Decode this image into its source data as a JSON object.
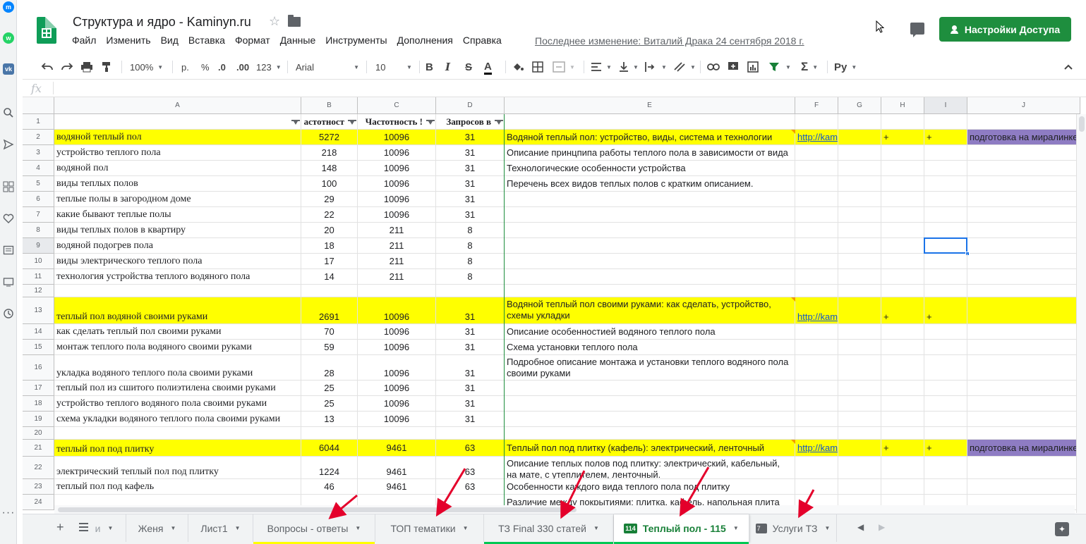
{
  "doc": {
    "title": "Структура и ядро - Kaminyn.ru",
    "menu": [
      "Файл",
      "Изменить",
      "Вид",
      "Вставка",
      "Формат",
      "Данные",
      "Инструменты",
      "Дополнения",
      "Справка"
    ],
    "last_edit": "Последнее изменение: Виталий Драка 24 сентября 2018 г.",
    "share_label": "Настройки Доступа"
  },
  "toolbar": {
    "zoom": "100%",
    "currency": "р.",
    "percent": "%",
    "dec_less": ".0",
    "dec_more": ".00",
    "format_more": "123",
    "font": "Arial",
    "font_size": "10",
    "bold": "B",
    "italic": "I",
    "strike": "S",
    "text_color": "A",
    "sigma": "Σ",
    "input_tools": "Pу"
  },
  "formula": {
    "fx": "fx",
    "value": ""
  },
  "columns": [
    "A",
    "B",
    "C",
    "D",
    "E",
    "F",
    "G",
    "H",
    "I",
    "J"
  ],
  "header_row": {
    "num": "1",
    "B": "астотност",
    "C": "Частотность !",
    "D": "Запросов в"
  },
  "rows": [
    {
      "num": "2",
      "A": "водяной теплый пол",
      "B": "5272",
      "C": "10096",
      "D": "31",
      "E": "Водяной теплый пол: устройство, виды, система и технологии",
      "F": "http://kaminyn.ru/tyo",
      "H": "+",
      "I": "+",
      "J": "подготовка на миралинке",
      "yellow": true
    },
    {
      "num": "3",
      "A": "устройство теплого пола",
      "B": "218",
      "C": "10096",
      "D": "31",
      "E": "Описание принцпипа работы теплого пола в зависимости от вида"
    },
    {
      "num": "4",
      "A": "водяной пол",
      "B": "148",
      "C": "10096",
      "D": "31",
      "E": "Технологические особенности устройства"
    },
    {
      "num": "5",
      "A": "виды теплых полов",
      "B": "100",
      "C": "10096",
      "D": "31",
      "E": "Перечень всех видов теплых полов с кратким описанием."
    },
    {
      "num": "6",
      "A": "теплые полы в загородном доме",
      "B": "29",
      "C": "10096",
      "D": "31"
    },
    {
      "num": "7",
      "A": "какие бывают теплые полы",
      "B": "22",
      "C": "10096",
      "D": "31"
    },
    {
      "num": "8",
      "A": "виды теплых полов в квартиру",
      "B": "20",
      "C": "211",
      "D": "8"
    },
    {
      "num": "9",
      "A": "водяной подогрев пола",
      "B": "18",
      "C": "211",
      "D": "8"
    },
    {
      "num": "10",
      "A": "виды электрического теплого пола",
      "B": "17",
      "C": "211",
      "D": "8"
    },
    {
      "num": "11",
      "A": "технология устройства теплого водяного пола",
      "B": "14",
      "C": "211",
      "D": "8"
    },
    {
      "num": "12"
    },
    {
      "num": "13",
      "A": "теплый пол водяной своими руками",
      "B": "2691",
      "C": "10096",
      "D": "31",
      "E": "Водяной теплый пол своими руками: как сделать, устройство, схемы укладки",
      "F": "http://kaminyn.ru/tyo",
      "H": "+",
      "I": "+",
      "yellow": true
    },
    {
      "num": "14",
      "A": "как сделать теплый пол своими руками",
      "B": "70",
      "C": "10096",
      "D": "31",
      "E": "Описание особенностией водяного теплого пола"
    },
    {
      "num": "15",
      "A": "монтаж теплого пола водяного своими руками",
      "B": "59",
      "C": "10096",
      "D": "31",
      "E": "Схема установки теплого пола"
    },
    {
      "num": "16",
      "A": "укладка водяного теплого пола своими руками",
      "B": "28",
      "C": "10096",
      "D": "31",
      "E": "Подробное описание монтажа и установки теплого водяного пола своими руками"
    },
    {
      "num": "17",
      "A": "теплый пол из сшитого полиэтилена своими руками",
      "B": "25",
      "C": "10096",
      "D": "31"
    },
    {
      "num": "18",
      "A": "устройство теплого водяного пола своими руками",
      "B": "25",
      "C": "10096",
      "D": "31"
    },
    {
      "num": "19",
      "A": "схема укладки водяного теплого пола своими руками",
      "B": "13",
      "C": "10096",
      "D": "31"
    },
    {
      "num": "20"
    },
    {
      "num": "21",
      "A": "теплый пол под плитку",
      "B": "6044",
      "C": "9461",
      "D": "63",
      "E": "Теплый пол под плитку (кафель): электрический, ленточный",
      "F": "http://kaminyn.ru/tyo",
      "H": "+",
      "I": "+",
      "J": "подготовка на миралинке",
      "yellow": true
    },
    {
      "num": "22",
      "A": "электрический теплый пол под плитку",
      "B": "1224",
      "C": "9461",
      "D": "63",
      "E": "Описание теплых полов под плитку: электрический, кабельный, на мате, с утеплителем, ленточный."
    },
    {
      "num": "23",
      "A": "теплый пол под кафель",
      "B": "46",
      "C": "9461",
      "D": "63",
      "E": "Особенности каждого вида теплого пола под плитку"
    },
    {
      "num": "24",
      "E": "Различие между покрытиями: плитка, кафель, напольная плита"
    }
  ],
  "tabs": [
    {
      "label": "и",
      "partial": true
    },
    {
      "label": "Женя"
    },
    {
      "label": "Лист1"
    },
    {
      "label": "Вопросы - ответы",
      "underline": "#ffff00"
    },
    {
      "label": "ТОП тематики"
    },
    {
      "label": "ТЗ Final 330 статей",
      "underline": "#00c853"
    },
    {
      "label": "Теплый пол - 115",
      "badge": "114",
      "active": true,
      "underline": "#00c853"
    },
    {
      "label": "Услуги ТЗ",
      "badge": "7"
    }
  ],
  "colors": {
    "yellow": "#ffff00",
    "purple": "#8e7cc3",
    "green": "#1e8e3e",
    "link": "#1155cc"
  }
}
